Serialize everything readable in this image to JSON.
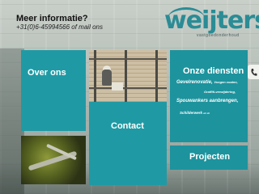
{
  "header": {
    "info_title": "Meer informatie?",
    "info_phone": "+31(0)6-45994566 of mail ons"
  },
  "logo": {
    "name": "weijters",
    "tagline": "vastgoedonderhoud"
  },
  "tiles": {
    "over_ons": "Over ons",
    "contact": "Contact",
    "projecten": "Projecten",
    "diensten": {
      "title": "Onze diensten",
      "line1_main": "Gevelrenovatie,",
      "line1_small": "Voegen coaten,",
      "line2": "Graffiti-verwijdering,",
      "line3": "Spouwankers aanbrengen,",
      "line4_main": "Schilderwerk",
      "line4_small": "etc etc"
    }
  },
  "colors": {
    "tile": "#1f9aa4",
    "logo": "#2a8c95"
  },
  "icons": {
    "side_button": "phone-icon"
  }
}
